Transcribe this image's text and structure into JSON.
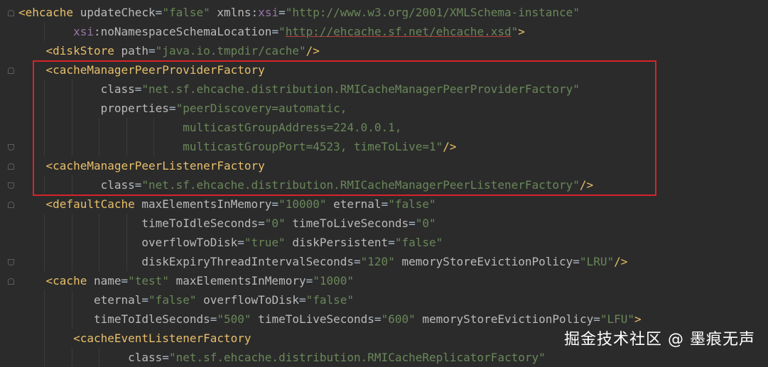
{
  "lines": [
    [
      [
        "tag",
        "<ehcache "
      ],
      [
        "attr",
        "updateCheck"
      ],
      [
        "plain",
        "="
      ],
      [
        "val",
        "\"false\""
      ],
      [
        "attr",
        " xmlns"
      ],
      [
        "plain",
        ":"
      ],
      [
        "ns",
        "xsi"
      ],
      [
        "plain",
        "="
      ],
      [
        "val",
        "\"http://www.w3.org/2001/XMLSchema-instance\""
      ]
    ],
    [
      [
        "plain",
        "        "
      ],
      [
        "ns",
        "xsi"
      ],
      [
        "plain",
        ":"
      ],
      [
        "attr",
        "noNamespaceSchemaLocation"
      ],
      [
        "plain",
        "="
      ],
      [
        "val",
        "\""
      ],
      [
        "url",
        "http://ehcache.sf.net/ehcache.xsd"
      ],
      [
        "val",
        "\""
      ],
      [
        "tag",
        ">"
      ]
    ],
    [
      [
        "plain",
        "    "
      ],
      [
        "tag",
        "<diskStore "
      ],
      [
        "attr",
        "path"
      ],
      [
        "plain",
        "="
      ],
      [
        "val",
        "\"java.io.tmpdir/cache\""
      ],
      [
        "tag",
        "/>"
      ]
    ],
    [
      [
        "plain",
        "    "
      ],
      [
        "tag",
        "<cacheManagerPeerProviderFactory"
      ]
    ],
    [
      [
        "plain",
        "            "
      ],
      [
        "attr",
        "class"
      ],
      [
        "plain",
        "="
      ],
      [
        "val",
        "\"net.sf.ehcache.distribution.RMICacheManagerPeerProviderFactory\""
      ]
    ],
    [
      [
        "plain",
        "            "
      ],
      [
        "attr",
        "properties"
      ],
      [
        "plain",
        "="
      ],
      [
        "val",
        "\"peerDiscovery=automatic,"
      ]
    ],
    [
      [
        "plain",
        "                        "
      ],
      [
        "val",
        "multicastGroupAddress=224.0.0.1,"
      ]
    ],
    [
      [
        "plain",
        "                        "
      ],
      [
        "val",
        "multicastGroupPort=4523, timeToLive=1\""
      ],
      [
        "tag",
        "/>"
      ]
    ],
    [
      [
        "plain",
        "    "
      ],
      [
        "tag",
        "<cacheManagerPeerListenerFactory"
      ]
    ],
    [
      [
        "plain",
        "            "
      ],
      [
        "attr",
        "class"
      ],
      [
        "plain",
        "="
      ],
      [
        "val",
        "\"net.sf.ehcache.distribution.RMICacheManagerPeerListenerFactory\""
      ],
      [
        "tag",
        "/>"
      ]
    ],
    [
      [
        "plain",
        "    "
      ],
      [
        "tag",
        "<defaultCache "
      ],
      [
        "attr",
        "maxElementsInMemory"
      ],
      [
        "plain",
        "="
      ],
      [
        "val",
        "\"10000\""
      ],
      [
        "attr",
        " eternal"
      ],
      [
        "plain",
        "="
      ],
      [
        "val",
        "\"false\""
      ]
    ],
    [
      [
        "plain",
        "                  "
      ],
      [
        "attr",
        "timeToIdleSeconds"
      ],
      [
        "plain",
        "="
      ],
      [
        "val",
        "\"0\""
      ],
      [
        "attr",
        " timeToLiveSeconds"
      ],
      [
        "plain",
        "="
      ],
      [
        "val",
        "\"0\""
      ]
    ],
    [
      [
        "plain",
        "                  "
      ],
      [
        "attr",
        "overflowToDisk"
      ],
      [
        "plain",
        "="
      ],
      [
        "val",
        "\"true\""
      ],
      [
        "attr",
        " diskPersistent"
      ],
      [
        "plain",
        "="
      ],
      [
        "val",
        "\"false\""
      ]
    ],
    [
      [
        "plain",
        "                  "
      ],
      [
        "attr",
        "diskExpiryThreadIntervalSeconds"
      ],
      [
        "plain",
        "="
      ],
      [
        "val",
        "\"120\""
      ],
      [
        "attr",
        " memoryStoreEvictionPolicy"
      ],
      [
        "plain",
        "="
      ],
      [
        "val",
        "\"LRU\""
      ],
      [
        "tag",
        "/>"
      ]
    ],
    [
      [
        "plain",
        "    "
      ],
      [
        "tag",
        "<cache "
      ],
      [
        "attr",
        "name"
      ],
      [
        "plain",
        "="
      ],
      [
        "val",
        "\"test\""
      ],
      [
        "attr",
        " maxElementsInMemory"
      ],
      [
        "plain",
        "="
      ],
      [
        "val",
        "\"1000\""
      ]
    ],
    [
      [
        "plain",
        "           "
      ],
      [
        "attr",
        "eternal"
      ],
      [
        "plain",
        "="
      ],
      [
        "val",
        "\"false\""
      ],
      [
        "attr",
        " overflowToDisk"
      ],
      [
        "plain",
        "="
      ],
      [
        "val",
        "\"false\""
      ]
    ],
    [
      [
        "plain",
        "           "
      ],
      [
        "attr",
        "timeToIdleSeconds"
      ],
      [
        "plain",
        "="
      ],
      [
        "val",
        "\"500\""
      ],
      [
        "attr",
        " timeToLiveSeconds"
      ],
      [
        "plain",
        "="
      ],
      [
        "val",
        "\"600\""
      ],
      [
        "attr",
        " memoryStoreEvictionPolicy"
      ],
      [
        "plain",
        "="
      ],
      [
        "val",
        "\"LFU\""
      ],
      [
        "tag",
        ">"
      ]
    ],
    [
      [
        "plain",
        "        "
      ],
      [
        "tag",
        "<cacheEventListenerFactory"
      ]
    ],
    [
      [
        "plain",
        "                "
      ],
      [
        "attr",
        "class"
      ],
      [
        "plain",
        "="
      ],
      [
        "val",
        "\"net.sf.ehcache.distribution.RMICacheReplicatorFactory\""
      ]
    ]
  ],
  "watermark": "掘金技术社区 @ 墨痕无声",
  "colors": {
    "background": "#2b2b2b",
    "tag": "#e8bf6a",
    "attribute": "#bababa",
    "namespace": "#9876aa",
    "value": "#6a8759",
    "highlight_box": "#d8232a"
  }
}
